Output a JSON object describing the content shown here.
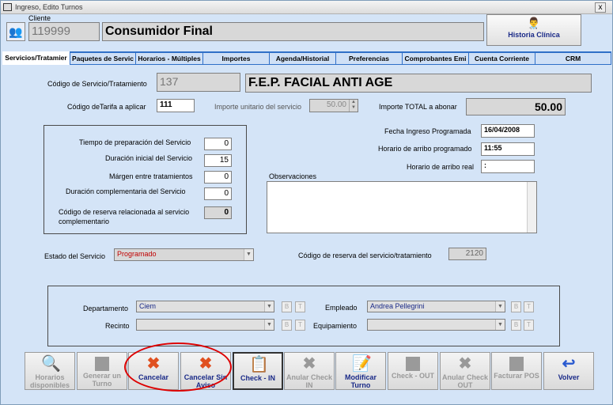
{
  "window": {
    "title": "Ingreso, Edito Turnos",
    "close": "x"
  },
  "header": {
    "client_label": "Cliente",
    "client_id": "119999",
    "client_name": "Consumidor Final",
    "historia_btn": "Historia Clínica"
  },
  "tabs": [
    {
      "label": "Servicios/Tratamier"
    },
    {
      "label": "Paquetes de Servic"
    },
    {
      "label": "Horarios - Múltiples"
    },
    {
      "label": "Importes"
    },
    {
      "label": "Agenda/Historial"
    },
    {
      "label": "Preferencias"
    },
    {
      "label": "Comprobantes Emi"
    },
    {
      "label": "Cuenta Corriente"
    },
    {
      "label": "CRM"
    }
  ],
  "service": {
    "code_label": "Código de Servicio/Tratamiento",
    "code": "137",
    "name": "F.E.P.  FACIAL ANTI AGE",
    "tarifa_label": "Código deTarifa a aplicar",
    "tarifa": "111",
    "unit_label": "Importe unitario del servicio",
    "unit_value": "50.00",
    "total_label": "Importe TOTAL a abonar",
    "total_value": "50.00"
  },
  "times": {
    "prep_label": "Tiempo de preparación del Servicio",
    "prep": "0",
    "initial_label": "Duración inicial del Servicio",
    "initial": "15",
    "margin_label": "Márgen entre tratamientos",
    "margin": "0",
    "compl_label": "Duración  complementaria  del Servicio",
    "compl": "0",
    "reserva_label_1": "Código de reserva relacionada al  servicio",
    "reserva_label_2": "complementario",
    "reserva": "0"
  },
  "schedule": {
    "fecha_label": "Fecha Ingreso Programada",
    "fecha": "16/04/2008",
    "arribo_prog_label": "Horario de arribo programado",
    "arribo_prog": "11:55",
    "arribo_real_label": "Horario de arribo real",
    "arribo_real": " :",
    "obs_label": "Observaciones"
  },
  "estado": {
    "label": "Estado del Servicio",
    "value": "Programado",
    "reserva_label": "Código de reserva del servicio/tratamiento",
    "reserva_value": "2120"
  },
  "resources": {
    "depto_label": "Departamento",
    "depto": "Ciem",
    "recinto_label": "Recinto",
    "recinto": "",
    "empleado_label": "Empleado",
    "empleado": "Andrea Pellegrini",
    "equip_label": "Equipamiento",
    "equip": "",
    "b": "B",
    "t": "T"
  },
  "buttons": [
    {
      "label": "Horarios disponibles",
      "icon": "search-icon"
    },
    {
      "label": "Generar un Turno",
      "icon": "square-icon"
    },
    {
      "label": "Cancelar",
      "icon": "x-icon"
    },
    {
      "label": "Cancelar Sin Aviso",
      "icon": "x-doc-icon"
    },
    {
      "label": "Check - IN",
      "icon": "clipboard-icon"
    },
    {
      "label": "Anular Check IN",
      "icon": "x-icon"
    },
    {
      "label": "Modificar Turno",
      "icon": "edit-icon"
    },
    {
      "label": "Check - OUT",
      "icon": "square-icon"
    },
    {
      "label": "Anular Check OUT",
      "icon": "x-icon"
    },
    {
      "label": "Facturar POS",
      "icon": "square-icon"
    },
    {
      "label": "Volver",
      "icon": "return-arrow-icon"
    }
  ],
  "colors": {
    "tab_bar": "#2f6fc7",
    "background": "#d4e4f7",
    "estado_text": "#c00000",
    "highlight_circle": "#dd0000"
  }
}
